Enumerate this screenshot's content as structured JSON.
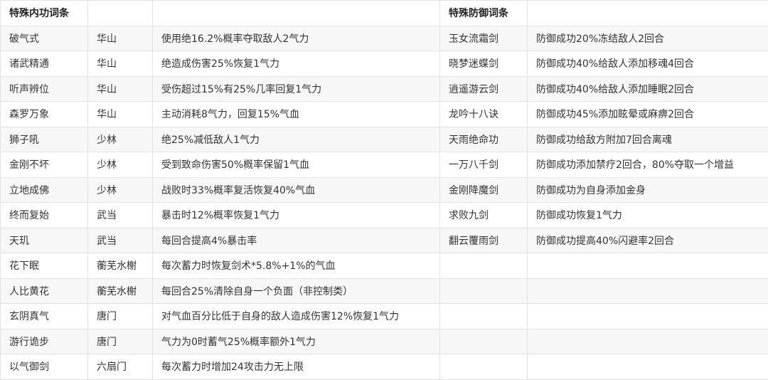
{
  "headers": {
    "internal_title": "特殊内功词条",
    "defense_title": "特殊防御词条"
  },
  "internal_rows": [
    {
      "name": "破气式",
      "sect": "华山",
      "effect": "使用绝16.2%概率夺取敌人2气力"
    },
    {
      "name": "诸武精通",
      "sect": "华山",
      "effect": "绝造成伤害25%恢复1气力"
    },
    {
      "name": "听声辨位",
      "sect": "华山",
      "effect": "受伤超过15%有25%几率回复1气力"
    },
    {
      "name": "森罗万象",
      "sect": "华山",
      "effect": "主动消耗8气力，回复15%气血"
    },
    {
      "name": "狮子吼",
      "sect": "少林",
      "effect": "绝25%减低敌人1气力"
    },
    {
      "name": "金刚不坏",
      "sect": "少林",
      "effect": "受到致命伤害50%概率保留1气血"
    },
    {
      "name": "立地成佛",
      "sect": "少林",
      "effect": "战败时33%概率复活恢复40%气血"
    },
    {
      "name": "终而复始",
      "sect": "武当",
      "effect": "暴击时12%概率恢复1气力"
    },
    {
      "name": "天玑",
      "sect": "武当",
      "effect": "每回合提高4%暴击率"
    },
    {
      "name": "花下眠",
      "sect": "蘅芜水榭",
      "effect": "每次蓄力时恢复剑术*5.8%+1%的气血"
    },
    {
      "name": "人比黄花",
      "sect": "蘅芜水榭",
      "effect": "每回合25%清除自身一个负面（非控制类）"
    },
    {
      "name": "玄阴真气",
      "sect": "唐门",
      "effect": "对气血百分比低于自身的敌人造成伤害12%恢复1气力"
    },
    {
      "name": "游行诡步",
      "sect": "唐门",
      "effect": "气力为0时蓄气25%概率额外1气力"
    },
    {
      "name": "以气御剑",
      "sect": "六扇门",
      "effect": "每次蓄力时增加24攻击力无上限"
    }
  ],
  "defense_rows": [
    {
      "name": "玉女流霜剑",
      "effect": "防御成功20%冻结敌人2回合"
    },
    {
      "name": "晓梦迷蝶剑",
      "effect": "防御成功40%给敌人添加移魂4回合"
    },
    {
      "name": "逍遥游云剑",
      "effect": "防御成功40%给敌人添加睡眠2回合"
    },
    {
      "name": "龙吟十八诀",
      "effect": "防御成功45%添加眩晕或麻痹2回合"
    },
    {
      "name": "天雨绝命功",
      "effect": "防御成功给敌方附加7回合离魂"
    },
    {
      "name": "一万八千剑",
      "effect": "防御成功添加禁疗2回合，80%夺取一个增益"
    },
    {
      "name": "金刚降魔剑",
      "effect": "防御成功为自身添加金身"
    },
    {
      "name": "求败九剑",
      "effect": "防御成功恢复1气力"
    },
    {
      "name": "翻云覆雨剑",
      "effect": "防御成功提高40%闪避率2回合"
    },
    {
      "name": "",
      "effect": ""
    },
    {
      "name": "",
      "effect": ""
    },
    {
      "name": "",
      "effect": ""
    },
    {
      "name": "",
      "effect": ""
    },
    {
      "name": "",
      "effect": ""
    }
  ]
}
